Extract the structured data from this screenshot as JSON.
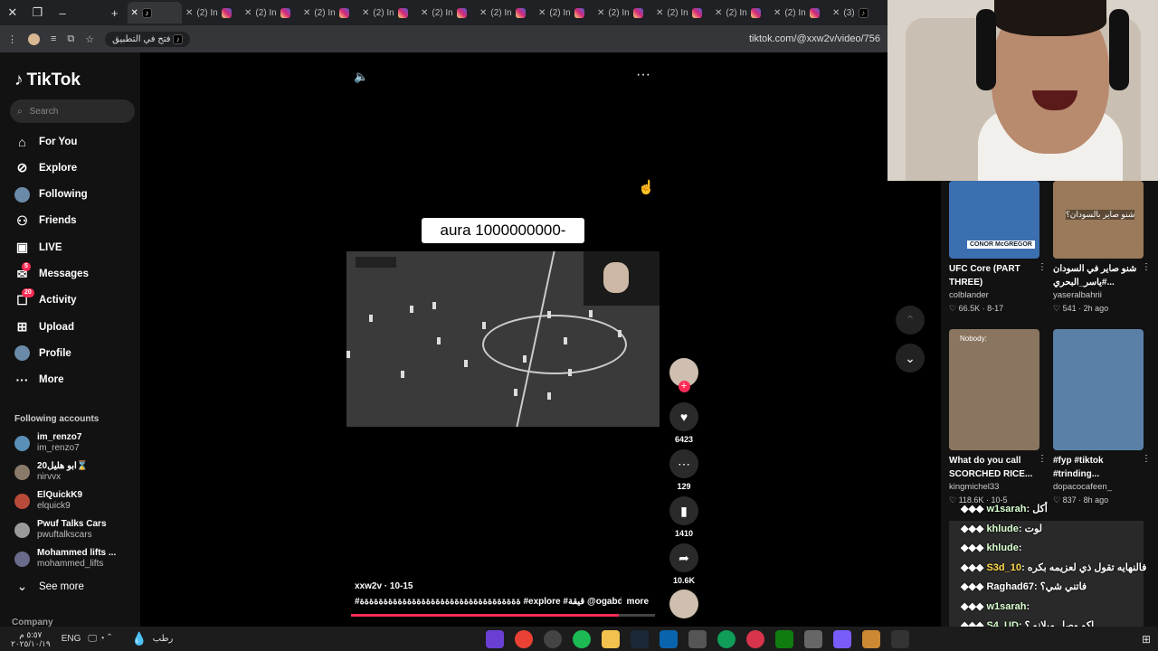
{
  "browser": {
    "tabs": [
      {
        "label": "(2) In",
        "icon": "instagram-icon"
      },
      {
        "label": "(2) In",
        "icon": "instagram-icon"
      },
      {
        "label": "(2) In",
        "icon": "instagram-icon"
      },
      {
        "label": "(2) In",
        "icon": "instagram-icon"
      },
      {
        "label": "(2) In",
        "icon": "instagram-icon"
      },
      {
        "label": "(2) In",
        "icon": "instagram-icon"
      },
      {
        "label": "(2) In",
        "icon": "instagram-icon"
      },
      {
        "label": "(2) In",
        "icon": "instagram-icon"
      },
      {
        "label": "(2) In",
        "icon": "instagram-icon"
      },
      {
        "label": "(2) In",
        "icon": "instagram-icon"
      },
      {
        "label": "(2) In",
        "icon": "instagram-icon"
      },
      {
        "label": "(3)",
        "icon": "tiktok-icon"
      }
    ],
    "open_in_app": "فتح في التطبيق",
    "url": "tiktok.com/@xxw2v/video/756"
  },
  "sidebar": {
    "logo": "TikTok",
    "search_placeholder": "Search",
    "nav": [
      {
        "label": "For You",
        "icon": "home-icon"
      },
      {
        "label": "Explore",
        "icon": "compass-icon"
      },
      {
        "label": "Following",
        "icon": "avatar-icon"
      },
      {
        "label": "Friends",
        "icon": "friends-icon"
      },
      {
        "label": "LIVE",
        "icon": "live-icon"
      },
      {
        "label": "Messages",
        "icon": "messages-icon",
        "badge": "5"
      },
      {
        "label": "Activity",
        "icon": "activity-icon",
        "badge": "20"
      },
      {
        "label": "Upload",
        "icon": "upload-icon"
      },
      {
        "label": "Profile",
        "icon": "avatar-icon"
      },
      {
        "label": "More",
        "icon": "more-icon"
      }
    ],
    "following_title": "Following accounts",
    "accounts": [
      {
        "name": "im_renzo7",
        "handle": "im_renzo7"
      },
      {
        "name": "ابو هليل20⌛",
        "handle": "nirvvx"
      },
      {
        "name": "ElQuickK9",
        "handle": "elquick9"
      },
      {
        "name": "Pwuf Talks Cars",
        "handle": "pwuftalkscars"
      },
      {
        "name": "Mohammed lifts ...",
        "handle": "mohammed_lifts"
      }
    ],
    "see_more": "See more",
    "company": "Company"
  },
  "video": {
    "overlay_text": "aura 1000000000-",
    "author_line": "xxw2v · 10-15",
    "caption": "#ةةةةةةةةةةةةةةةةةةةةةةةةةةةةةةةةةة #explore #قيقة @ogabdullah",
    "more": "more",
    "actions": [
      {
        "icon": "heart-icon",
        "count": "6423"
      },
      {
        "icon": "comment-icon",
        "count": "129"
      },
      {
        "icon": "bookmark-icon",
        "count": "1410"
      },
      {
        "icon": "share-icon",
        "count": "10.6K"
      }
    ],
    "progress": 0.88
  },
  "related": [
    {
      "caption": "UFC Core (PART THREE)",
      "user": "colblander",
      "likes": "66.5K",
      "date": "8-17",
      "color": "#3b6fb0"
    },
    {
      "caption": "شنو صاير في السودان #ياسر_البحري...",
      "user": "yaseralbahrii",
      "likes": "541",
      "date": "2h ago",
      "color": "#9a7a5a"
    },
    {
      "caption": "What do you call SCORCHED RICE...",
      "user": "kingmichel33",
      "likes": "118.6K",
      "date": "10-5",
      "color": "#8a7560"
    },
    {
      "caption": "#fyp #tiktok #trinding...",
      "user": "dopacocafeen_",
      "likes": "837",
      "date": "8h ago",
      "color": "#5a80a8"
    }
  ],
  "thumb_text": {
    "ufc": "CONOR McGREGOR",
    "sudan": "شنو صاير بالسودان؟",
    "nobody": "Nobody:"
  },
  "chat": [
    {
      "user": "w1sarah",
      "msg": ": أكل"
    },
    {
      "user": "khlude",
      "msg": ": لوت"
    },
    {
      "user": "khlude",
      "msg": ":"
    },
    {
      "user": "S3d_10",
      "msg": ": فالنهايه تقول ذي لعزيمه بكره"
    },
    {
      "user": "Raghad67",
      "msg": ": فاتني شي؟"
    },
    {
      "user": "w1sarah",
      "msg": ":"
    },
    {
      "user": "S4_UD",
      "msg": ": اكو وصل ميلانو ؟"
    }
  ],
  "taskbar": {
    "weather": "رطب",
    "lang": "ENG",
    "time": "٥:٥٧ م",
    "date": "٢٠٢٥/١٠/١٩"
  }
}
